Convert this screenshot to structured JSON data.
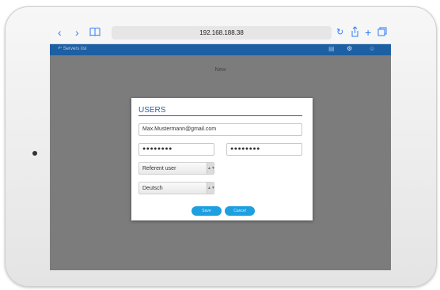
{
  "browser": {
    "url": "192.168.188.38",
    "back_icon": "‹",
    "forward_icon": "›",
    "bookmarks_icon": "book-icon",
    "reload_icon": "reload-icon",
    "share_icon": "share-icon",
    "add_icon": "plus-icon",
    "tabs_icon": "tabs-icon"
  },
  "app_bar": {
    "servers_label": "Servers list",
    "color": "#1d5fa3"
  },
  "page": {
    "title": "New"
  },
  "dialog": {
    "title": "USERS",
    "email_value": "Max.Mustermann@gmail.com",
    "password_value": "●●●●●●●●",
    "password_confirm_value": "●●●●●●●●",
    "role_value": "Referent user",
    "language_value": "Deutsch",
    "save_label": "Save",
    "cancel_label": "Cancel",
    "accent_color": "#1e9fe0"
  }
}
